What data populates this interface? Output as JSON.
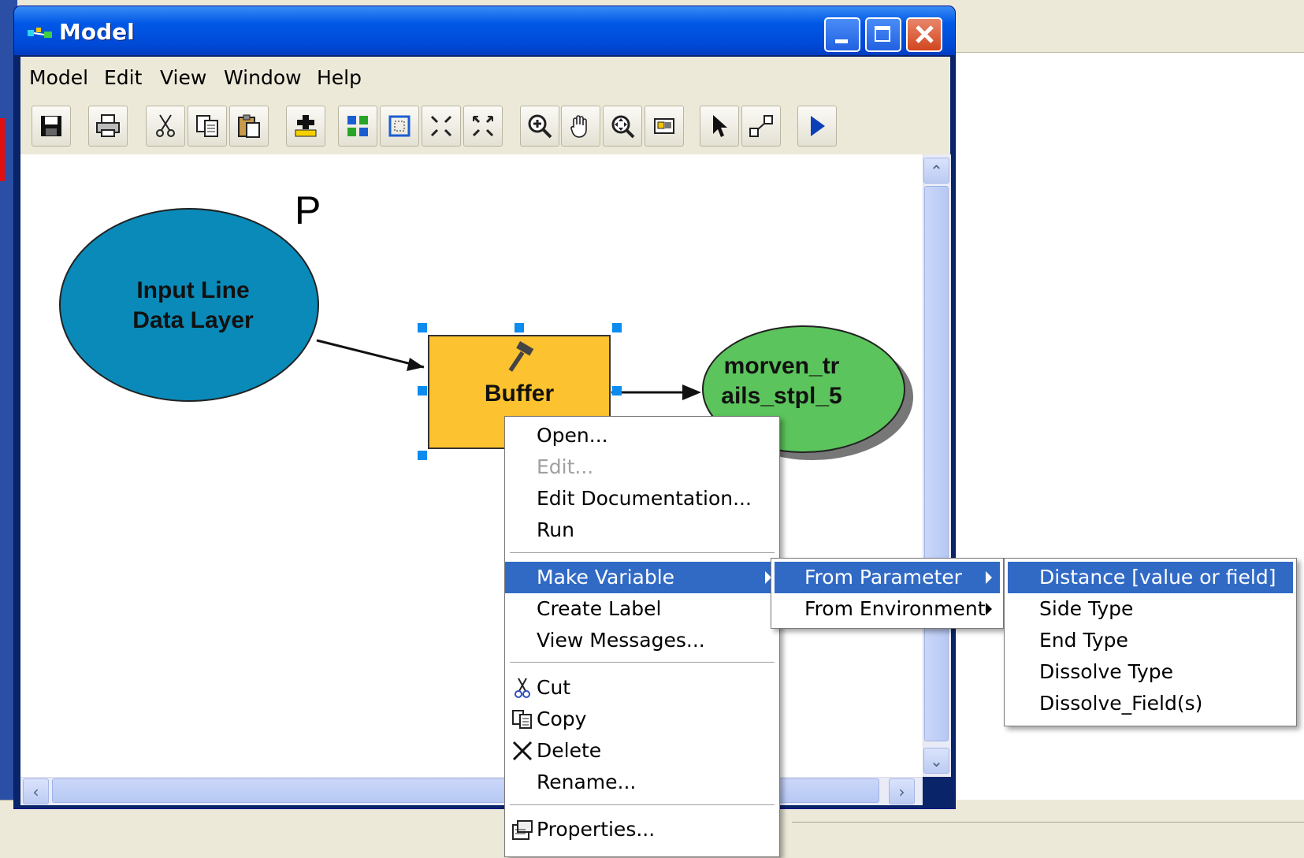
{
  "window": {
    "title": "Model"
  },
  "menubar": [
    "Model",
    "Edit",
    "View",
    "Window",
    "Help"
  ],
  "toolbar": {
    "icons": [
      "save-icon",
      "print-icon",
      "cut-icon",
      "copy-icon",
      "paste-icon",
      "add-data-icon",
      "auto-layout-icon",
      "full-extent-icon",
      "zoom-in-fixed-icon",
      "zoom-out-fixed-icon",
      "zoom-in-icon",
      "pan-icon",
      "zoom-to-layer-icon",
      "overview-icon",
      "select-icon",
      "connect-icon",
      "run-icon"
    ]
  },
  "diagram": {
    "p_marker": "P",
    "input_node": {
      "line1": "Input Line",
      "line2": "Data Layer",
      "color": "#0a8ab8"
    },
    "tool_node": {
      "label": "Buffer",
      "color": "#fcc22f"
    },
    "output_node": {
      "line1": "morven_tr",
      "line2": "ails_stpl_5",
      "color": "#5cc45c"
    }
  },
  "context_menu": {
    "items": [
      {
        "label": "Open...",
        "enabled": true
      },
      {
        "label": "Edit...",
        "enabled": false
      },
      {
        "label": "Edit Documentation...",
        "enabled": true
      },
      {
        "label": "Run",
        "enabled": true
      },
      {
        "label": "Make Variable",
        "enabled": true,
        "submenu": true,
        "highlighted": true
      },
      {
        "label": "Create Label",
        "enabled": true
      },
      {
        "label": "View Messages...",
        "enabled": true
      },
      {
        "label": "Cut",
        "enabled": true,
        "icon": "cut-icon"
      },
      {
        "label": "Copy",
        "enabled": true,
        "icon": "copy-icon"
      },
      {
        "label": "Delete",
        "enabled": true,
        "icon": "delete-icon"
      },
      {
        "label": "Rename...",
        "enabled": true
      },
      {
        "label": "Properties...",
        "enabled": true,
        "icon": "properties-icon"
      }
    ]
  },
  "make_variable_submenu": {
    "items": [
      {
        "label": "From Parameter",
        "highlighted": true,
        "submenu": true
      },
      {
        "label": "From Environment",
        "submenu": true
      }
    ]
  },
  "parameter_submenu": {
    "items": [
      {
        "label": "Distance [value or field]",
        "highlighted": true
      },
      {
        "label": "Side Type"
      },
      {
        "label": "End Type"
      },
      {
        "label": "Dissolve Type"
      },
      {
        "label": "Dissolve_Field(s)"
      }
    ]
  },
  "colors": {
    "title_bar": "#0058e6",
    "menu_highlight": "#316ac5",
    "chrome": "#ece9d8"
  }
}
